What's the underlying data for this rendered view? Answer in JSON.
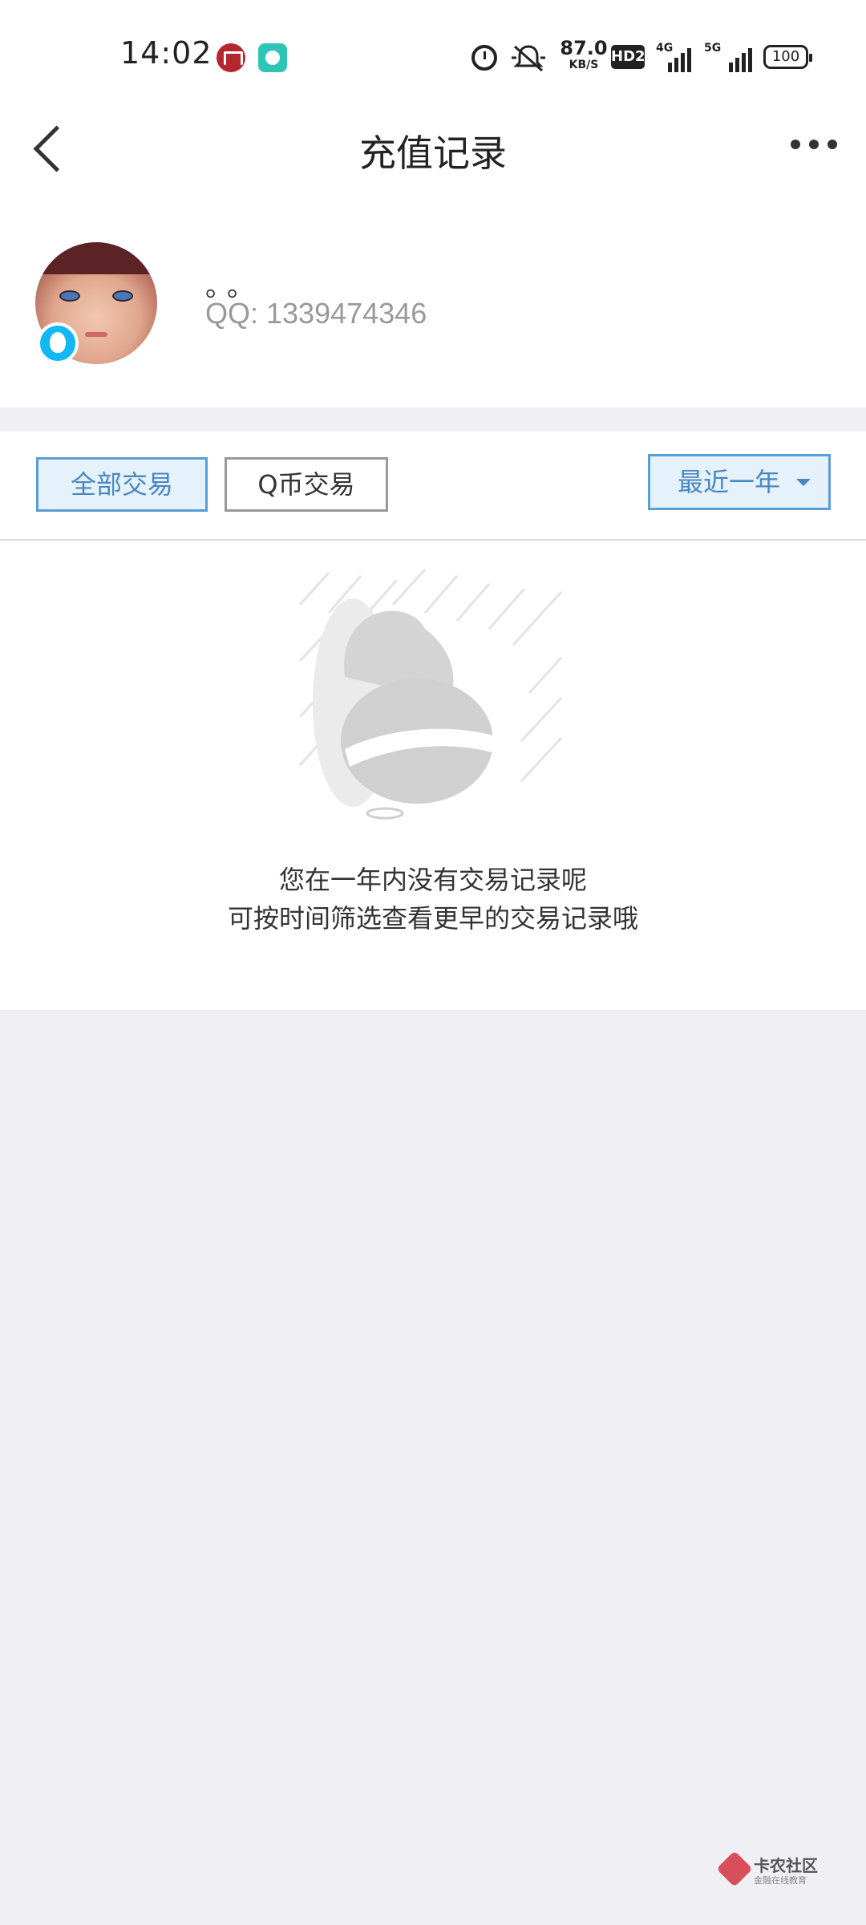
{
  "status_bar": {
    "time": "14:02",
    "net_speed_value": "87.0",
    "net_speed_unit": "KB/S",
    "hd_label": "HD2",
    "signal1_label": "4G",
    "signal2_label": "5G",
    "battery": "100"
  },
  "nav": {
    "title": "充值记录"
  },
  "profile": {
    "nickname": "。。",
    "qq_label": "QQ: 1339474346"
  },
  "filters": {
    "all_label": "全部交易",
    "qb_label": "Q币交易",
    "period_label": "最近一年"
  },
  "empty_state": {
    "line1": "您在一年内没有交易记录呢",
    "line2": "可按时间筛选查看更早的交易记录哦"
  },
  "watermark": {
    "title": "卡农社区",
    "subtitle": "金融在线教育"
  },
  "colors": {
    "accent": "#4a87c0",
    "accent_bg": "#e6f2fb",
    "page_bg": "#efeff4",
    "qq_blue": "#12b7f5"
  }
}
